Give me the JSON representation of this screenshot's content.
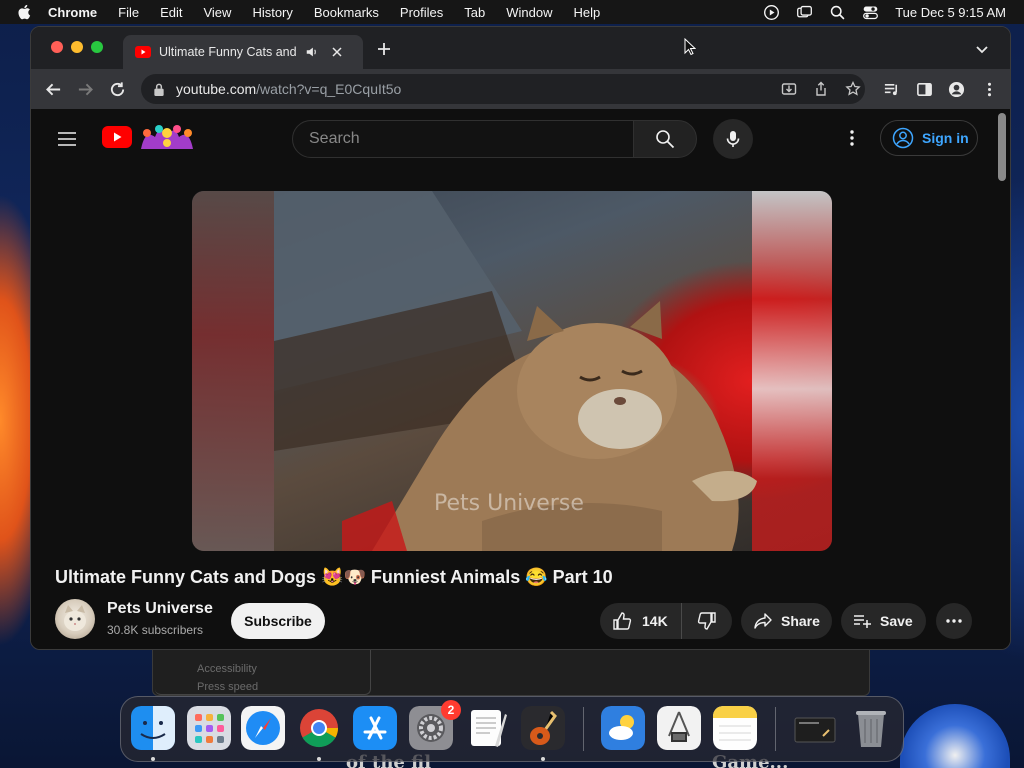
{
  "menubar": {
    "app_name": "Chrome",
    "items": [
      "File",
      "Edit",
      "View",
      "History",
      "Bookmarks",
      "Profiles",
      "Tab",
      "Window",
      "Help"
    ],
    "datetime": "Tue Dec 5  9:15 AM"
  },
  "browser": {
    "tab_title": "Ultimate Funny Cats and Dogs",
    "url_host": "youtube.com",
    "url_path": "/watch?v=q_E0CquIt5o"
  },
  "youtube": {
    "search_placeholder": "Search",
    "sign_in_label": "Sign in",
    "video_watermark": "Pets Universe",
    "video_title": "Ultimate Funny Cats and Dogs 😻🐶 Funniest Animals 😂 Part 10",
    "channel_name": "Pets Universe",
    "subscriber_count": "30.8K subscribers",
    "subscribe_label": "Subscribe",
    "like_count": "14K",
    "share_label": "Share",
    "save_label": "Save"
  },
  "background": {
    "ghost_line_1": "Accessibility",
    "ghost_line_2": "Press speed",
    "bottom_left_text": "of the fil",
    "bottom_right_text": "Game..."
  },
  "dock": {
    "apps": [
      "Finder",
      "Launchpad",
      "Safari",
      "Google Chrome",
      "App Store",
      "System Settings",
      "TextEdit",
      "GarageBand",
      "Weather",
      "System Information",
      "Notes",
      "Screenshot",
      "Trash"
    ],
    "settings_badge": "2"
  },
  "colors": {
    "youtube_red": "#ff0000",
    "link_blue": "#3ea6ff",
    "page_bg": "#0f0f0f"
  }
}
